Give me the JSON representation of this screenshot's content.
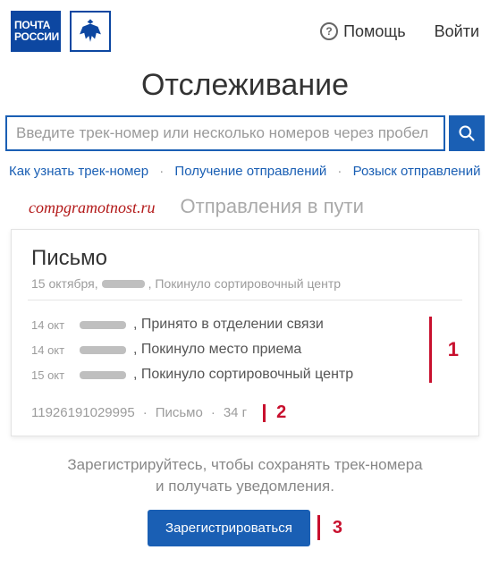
{
  "header": {
    "logo_line1": "ПОЧТА",
    "logo_line2": "РОССИИ",
    "help_label": "Помощь",
    "login_label": "Войти"
  },
  "page_title": "Отслеживание",
  "search": {
    "placeholder": "Введите трек-номер или несколько номеров через пробел"
  },
  "subnav": {
    "how_to": "Как узнать трек-номер",
    "receiving": "Получение отправлений",
    "search_lost": "Розыск отправлений"
  },
  "watermark": "compgramotnost.ru",
  "in_transit_label": "Отправления в пути",
  "card": {
    "title": "Письмо",
    "subtitle_date": "15 октября,",
    "subtitle_status": ", Покинуло сортировочный центр",
    "events": [
      {
        "date": "14 окт",
        "status": ", Принято в отделении связи"
      },
      {
        "date": "14 окт",
        "status": ", Покинуло место приема"
      },
      {
        "date": "15 окт",
        "status": ", Покинуло сортировочный центр"
      }
    ],
    "footer": {
      "track_number": "11926191029995",
      "type": "Письмо",
      "weight": "34 г"
    }
  },
  "annotations": {
    "a1": "1",
    "a2": "2",
    "a3": "3"
  },
  "cta": {
    "text_line1": "Зарегистрируйтесь, чтобы сохранять трек-номера",
    "text_line2": "и получать уведомления.",
    "button": "Зарегистрироваться"
  }
}
